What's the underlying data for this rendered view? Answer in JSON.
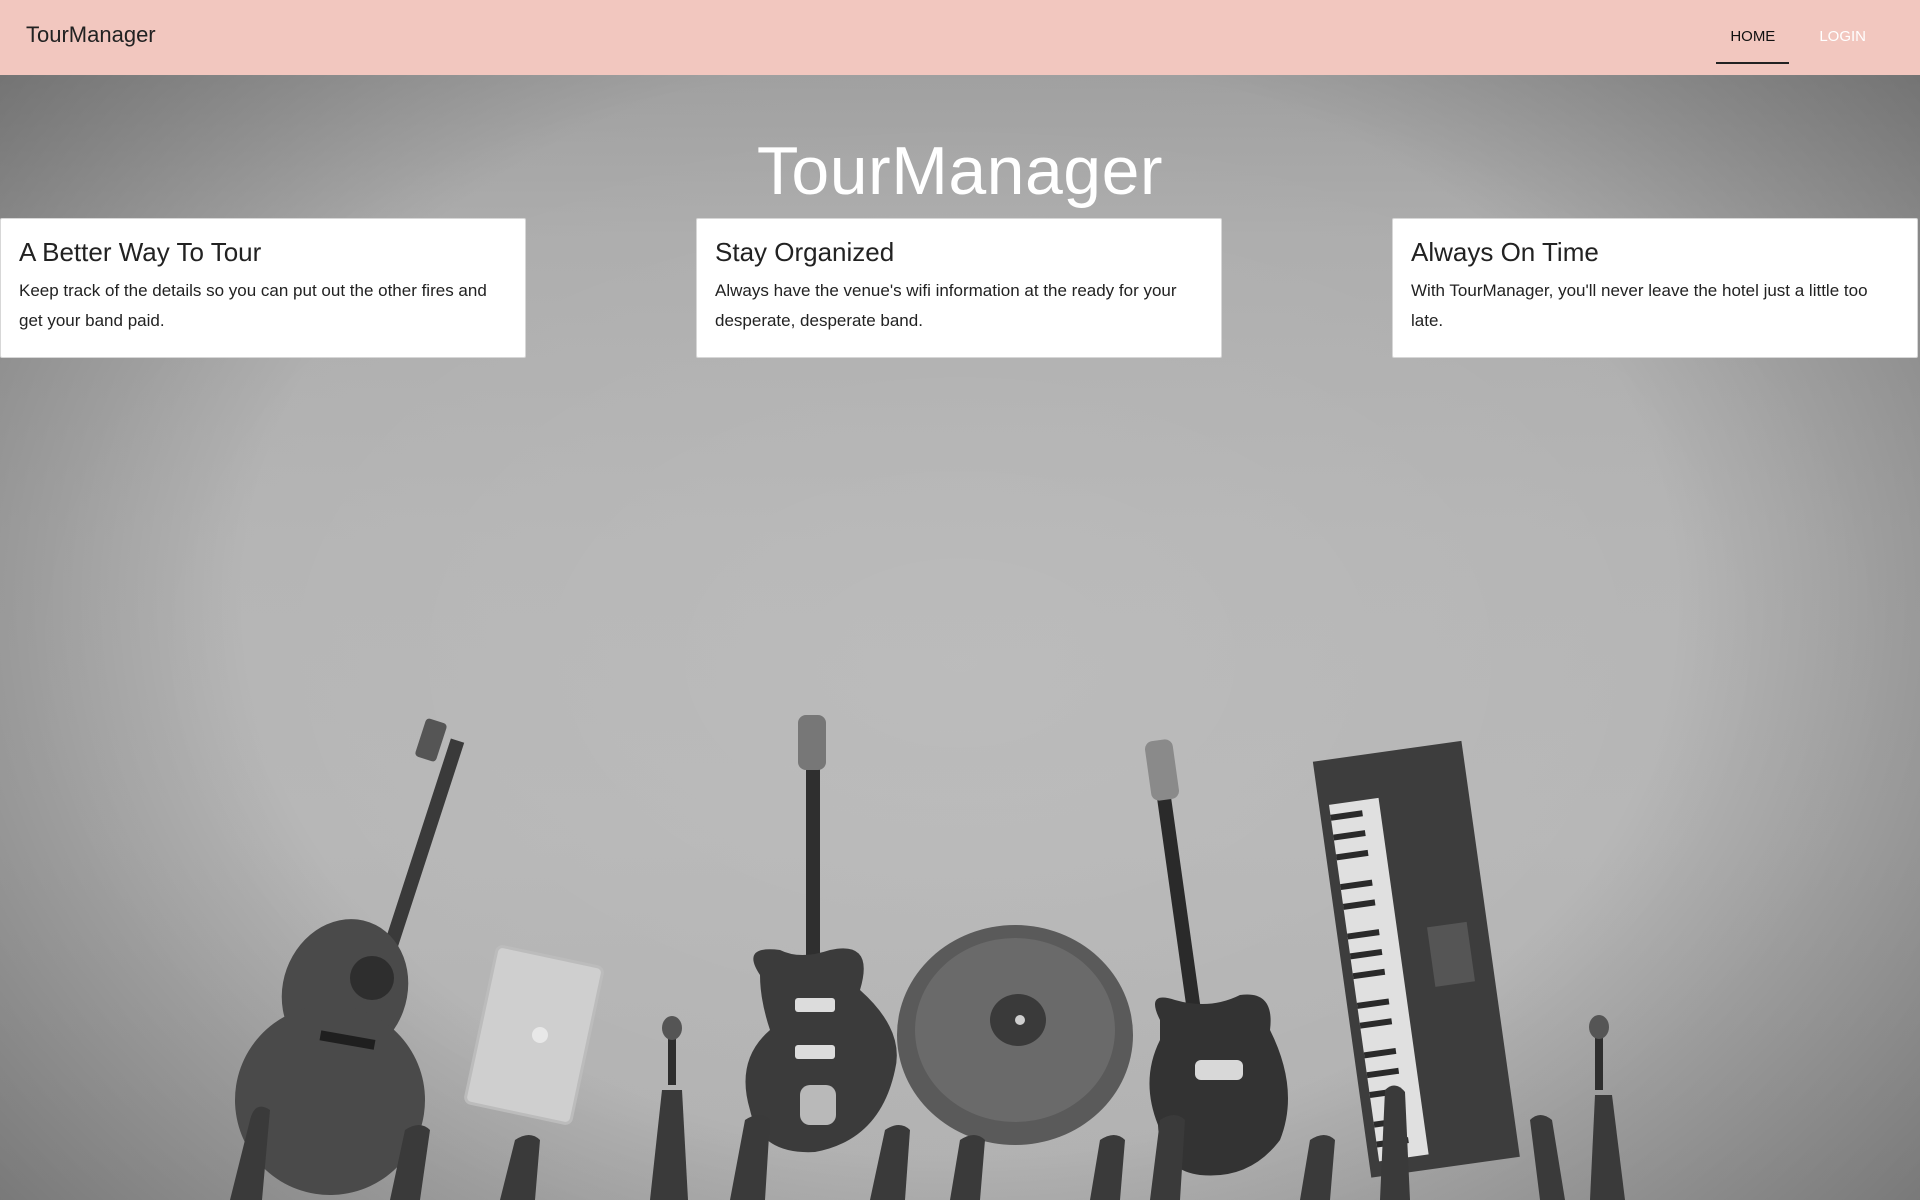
{
  "navbar": {
    "brand": "TourManager",
    "links": [
      {
        "label": "HOME",
        "active": true
      },
      {
        "label": "LOGIN",
        "active": false
      }
    ],
    "background_color": "#f2c7bf"
  },
  "hero": {
    "title": "TourManager"
  },
  "cards": [
    {
      "title": "A Better Way To Tour",
      "text": "Keep track of the details so you can put out the other fires and get your band paid."
    },
    {
      "title": "Stay Organized",
      "text": "Always have the venue's wifi information at the ready for your desperate, desperate band."
    },
    {
      "title": "Always On Time",
      "text": "With TourManager, you'll never leave the hotel just a little too late."
    }
  ],
  "background_image": {
    "description_icon": "band-instruments-photo"
  }
}
